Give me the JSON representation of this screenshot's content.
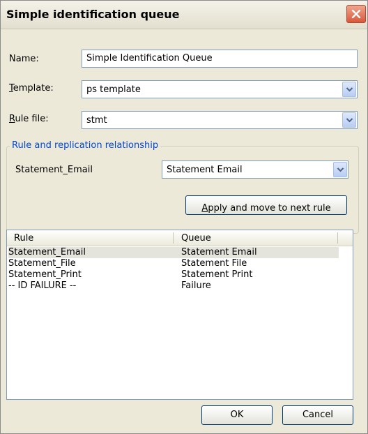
{
  "window": {
    "title": "Simple identification queue"
  },
  "form": {
    "name_label": "Name:",
    "name_value": "Simple Identification Queue",
    "template_label_pre": "",
    "template_label_u": "T",
    "template_label_post": "emplate:",
    "template_value": "ps template",
    "rule_file_label_pre": "",
    "rule_file_label_u": "R",
    "rule_file_label_post": "ule file:",
    "rule_file_value": "stmt"
  },
  "group": {
    "legend": "Rule and replication relationship",
    "rule_name": "Statement_Email",
    "queue_value": "Statement Email",
    "apply_label_u": "A",
    "apply_label_post": "pply and move to next rule"
  },
  "list": {
    "columns": [
      "Rule",
      "Queue"
    ],
    "rows": [
      {
        "rule": "Statement_Email",
        "queue": "Statement Email",
        "selected": true
      },
      {
        "rule": "Statement_File",
        "queue": "Statement File",
        "selected": false
      },
      {
        "rule": "Statement_Print",
        "queue": "Statement Print",
        "selected": false
      },
      {
        "rule": "-- ID FAILURE --",
        "queue": "Failure",
        "selected": false
      }
    ]
  },
  "buttons": {
    "ok": "OK",
    "cancel": "Cancel"
  },
  "icons": {
    "close": "close-icon",
    "dropdown": "chevron-down-icon"
  }
}
